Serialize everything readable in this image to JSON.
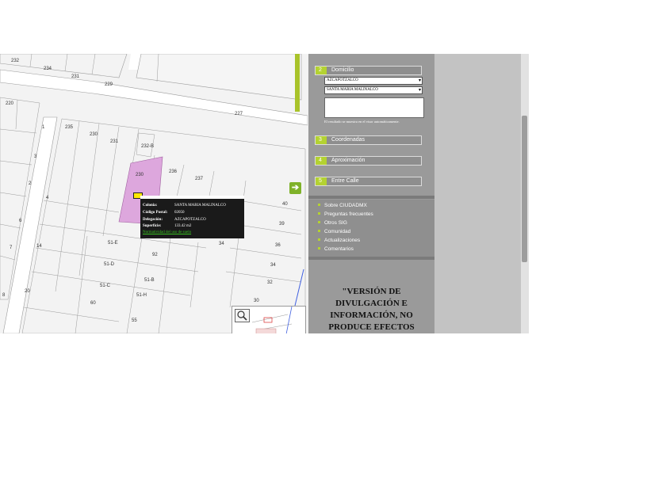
{
  "map": {
    "lot_numbers": [
      "232",
      "234",
      "231",
      "229",
      "227",
      "220",
      "1",
      "235",
      "230",
      "231",
      "232-B",
      "3",
      "230",
      "236",
      "237",
      "2",
      "4",
      "6",
      "7",
      "14",
      "8",
      "20",
      "60",
      "55",
      "51-E",
      "51-D",
      "51-C",
      "51-B",
      "51-H",
      "92",
      "34",
      "34",
      "36",
      "39",
      "40",
      "32",
      "30"
    ],
    "nav_arrow_glyph": "➔",
    "zoom_icon": "magnifier-icon",
    "highlight_color": "#dda7dd"
  },
  "info_popup": {
    "rows": [
      {
        "key": "Colonia:",
        "value": "SANTA MARIA MALINALCO"
      },
      {
        "key": "Código Postal:",
        "value": "02050"
      },
      {
        "key": "Delegación:",
        "value": "AZCAPOTZALCO"
      },
      {
        "key": "Superficie:",
        "value": "133.42 m2"
      }
    ],
    "link": "Normatividad del uso de suelo"
  },
  "panel": {
    "steps": [
      {
        "num": "2",
        "label": "Domicilio"
      },
      {
        "num": "3",
        "label": "Coordenadas"
      },
      {
        "num": "4",
        "label": "Aproximación"
      },
      {
        "num": "5",
        "label": "Entre Calle"
      }
    ],
    "delegacion_select": "AZCAPOTZALCO",
    "colonia_select": "SANTA MARIA MALINALCO",
    "note": "El resultado se muestra en el visor automáticamente.",
    "links": [
      "Sobre CIUDADMX",
      "Preguntas frecuentes",
      "Otros SIG",
      "Comunidad",
      "Actualizaciones",
      "Comentarios"
    ],
    "disclaimer": [
      "\"VERSIÓN DE",
      "DIVULGACIÓN E",
      "INFORMACIÓN, NO",
      "PRODUCE EFECTOS"
    ],
    "accent": "#b4d231"
  }
}
